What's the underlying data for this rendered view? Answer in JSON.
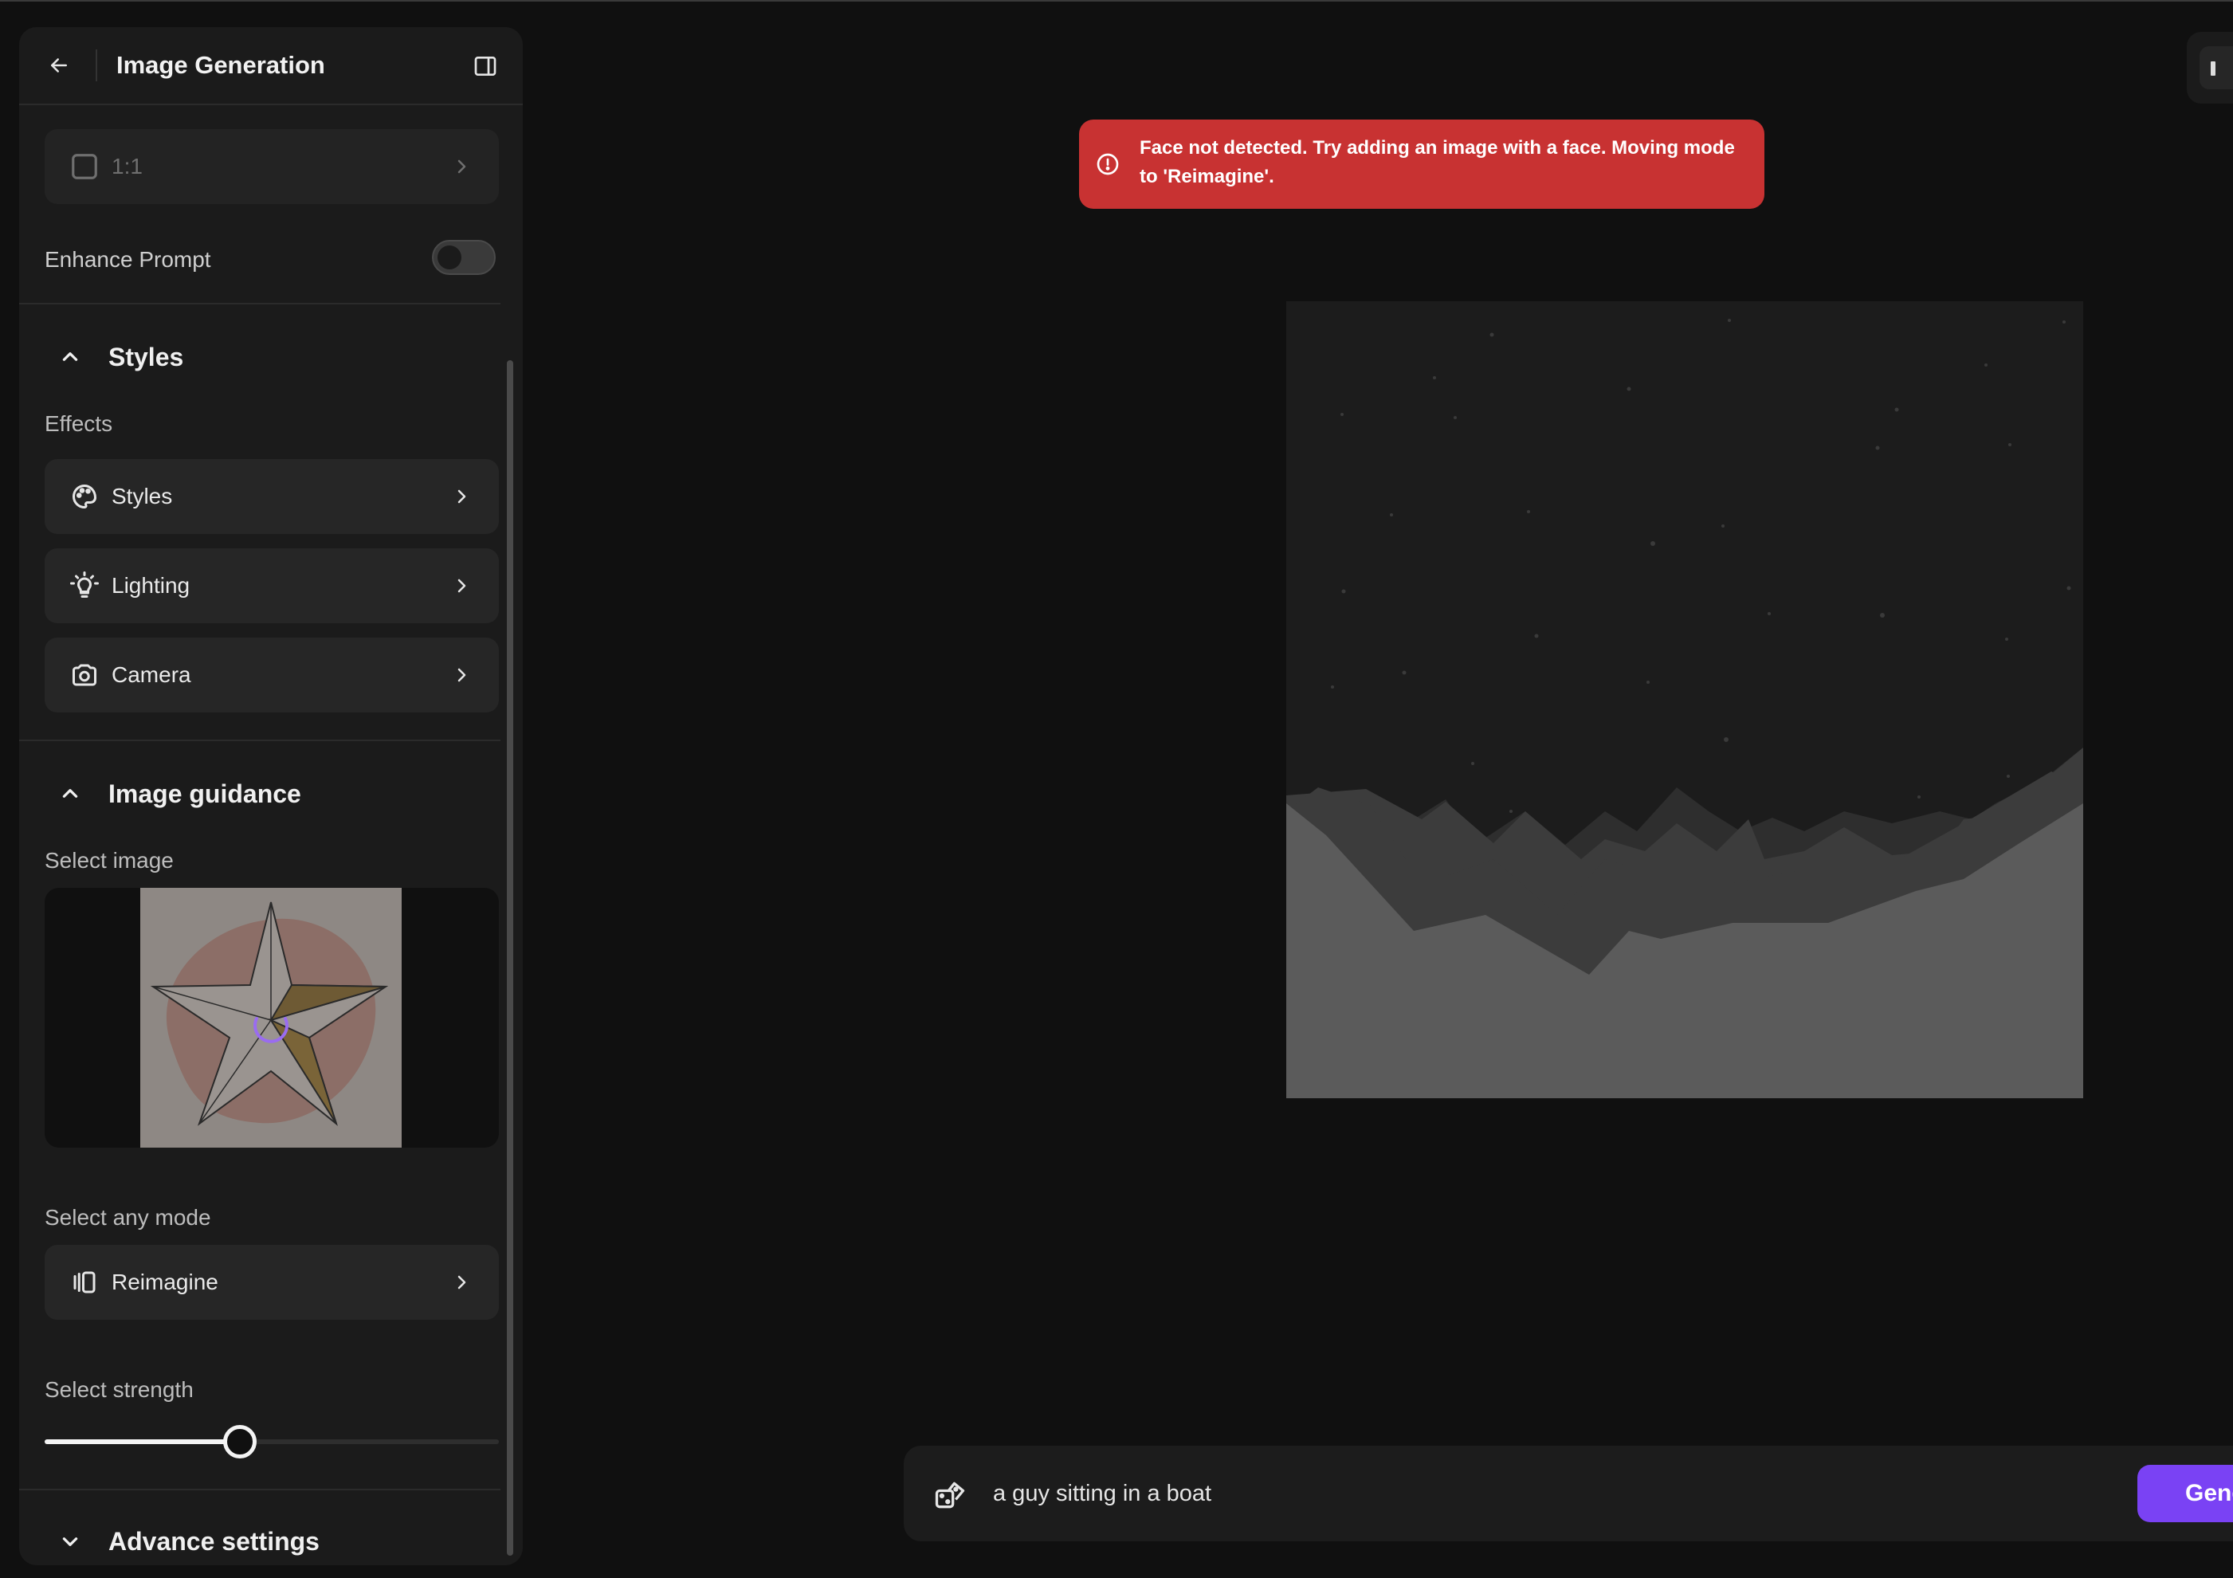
{
  "sidebar": {
    "title": "Image Generation",
    "aspect_ratio": "1:1",
    "enhance_prompt_label": "Enhance Prompt",
    "enhance_prompt_enabled": false,
    "styles_section": {
      "title": "Styles",
      "effects_label": "Effects",
      "items": [
        {
          "label": "Styles",
          "icon": "palette-icon"
        },
        {
          "label": "Lighting",
          "icon": "lightbulb-icon"
        },
        {
          "label": "Camera",
          "icon": "camera-icon"
        }
      ]
    },
    "image_guidance": {
      "title": "Image guidance",
      "select_image_label": "Select image",
      "select_mode_label": "Select any mode",
      "mode_value": "Reimagine",
      "mode_icon": "reimagine-icon",
      "select_strength_label": "Select strength",
      "strength": 0.43
    },
    "advance_settings": {
      "title": "Advance settings"
    }
  },
  "toast": {
    "message": "Face not detected. Try adding an image with a face. Moving mode to 'Reimagine'.",
    "color": "#c83232"
  },
  "prompt": {
    "text": "a guy sitting in a boat",
    "generate_label": "Generate"
  },
  "colors": {
    "accent": "#7a42f4",
    "background": "#101010",
    "panel": "#1b1b1b"
  }
}
